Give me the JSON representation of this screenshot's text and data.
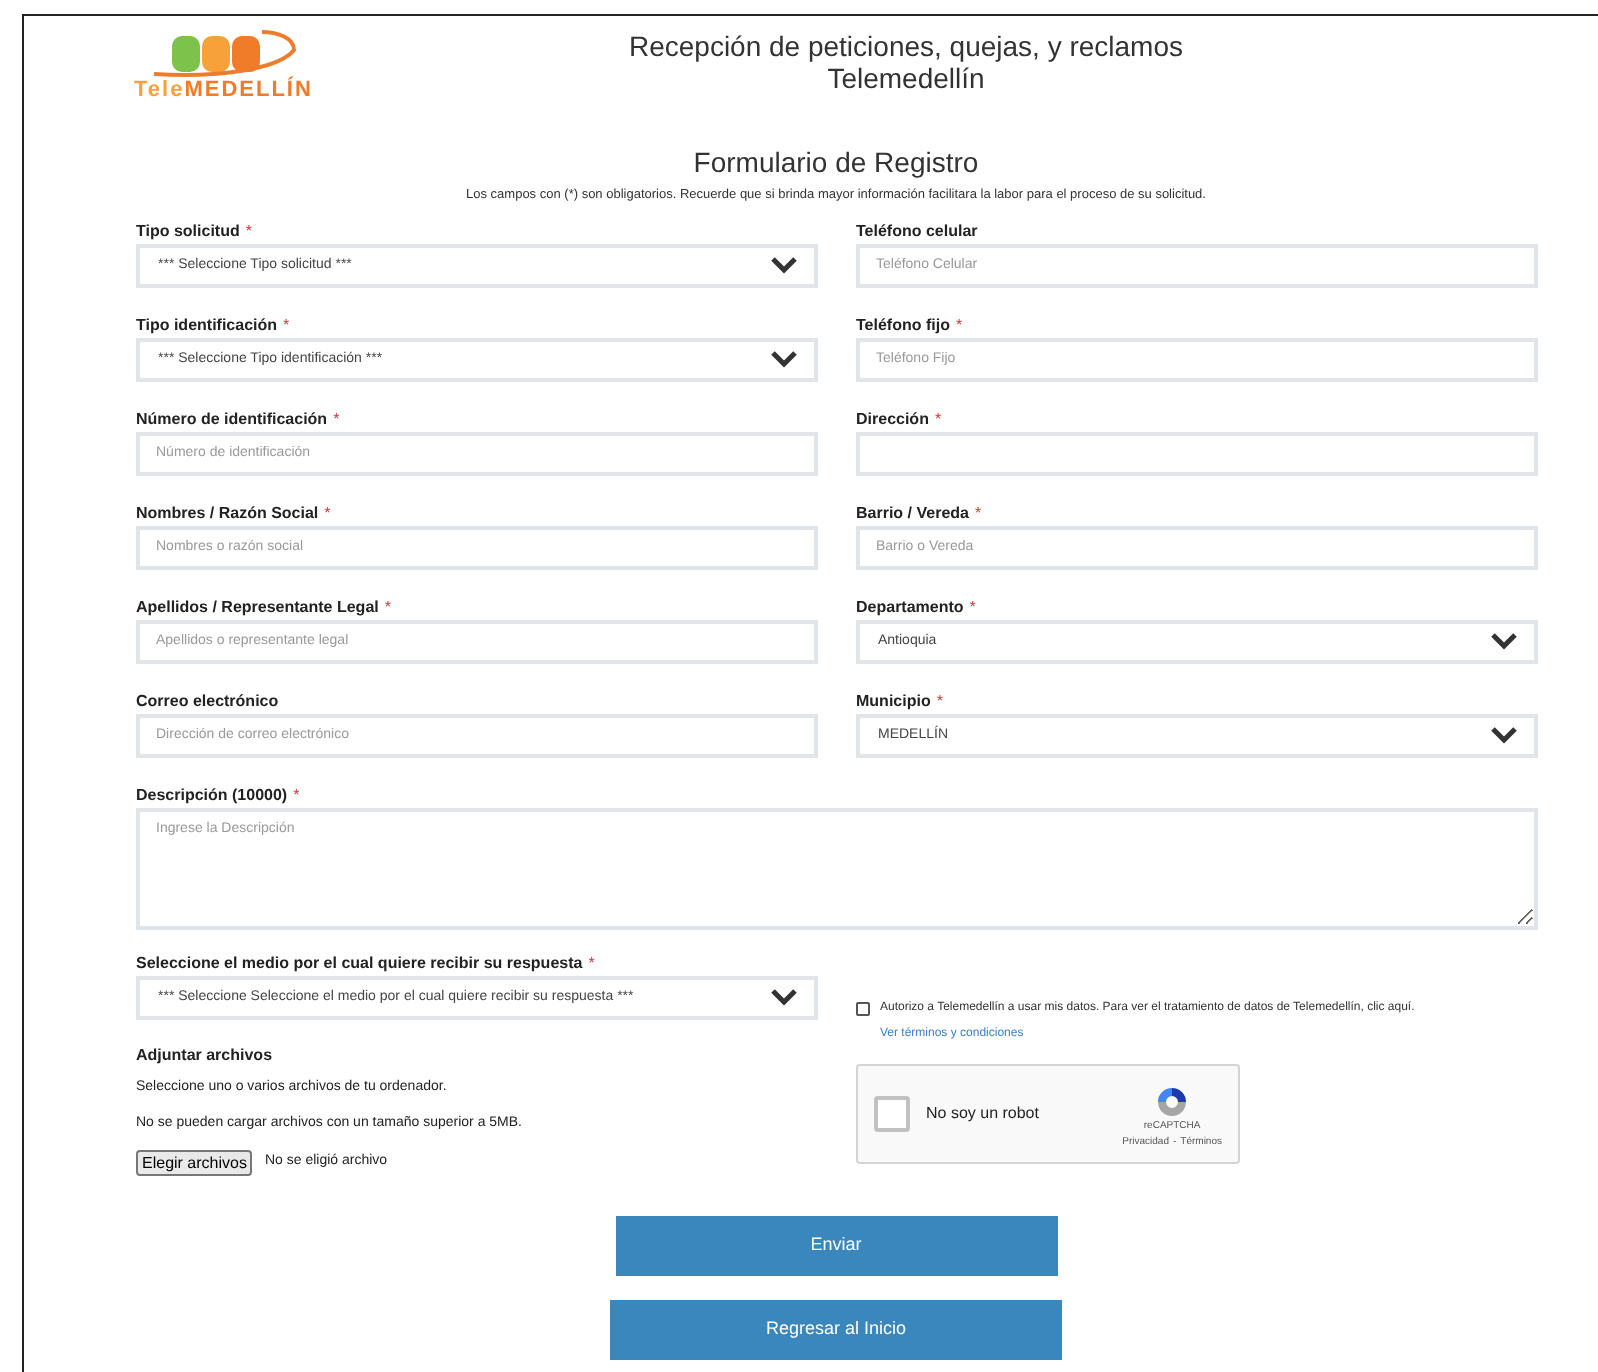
{
  "logo": {
    "part_1": "Tele",
    "part_2": "MEDELLÍN"
  },
  "header": {
    "title_line_1": "Recepción de peticiones, quejas, y reclamos",
    "title_line_2": "Telemedellín"
  },
  "form": {
    "title": "Formulario de Registro",
    "required_marker": "*",
    "note": "Los campos con (*) son obligatorios. Recuerde que si brinda mayor información facilitara la labor para el proceso de su solicitud.",
    "rows": [
      [
        {
          "kind": "select",
          "label": "Tipo solicitud",
          "required": true,
          "value": "*** Seleccione Tipo solicitud ***"
        },
        {
          "kind": "text",
          "label": "Teléfono celular",
          "required": false,
          "placeholder": "Teléfono Celular"
        }
      ],
      [
        {
          "kind": "select",
          "label": "Tipo identificación",
          "required": true,
          "value": "*** Seleccione Tipo identificación ***"
        },
        {
          "kind": "text",
          "label": "Teléfono fijo",
          "required": true,
          "placeholder": "Teléfono Fijo"
        }
      ],
      [
        {
          "kind": "text",
          "label": "Número de identificación",
          "required": true,
          "placeholder": "Número de identificación"
        },
        {
          "kind": "text",
          "label": "Dirección",
          "required": true
        }
      ],
      [
        {
          "kind": "text",
          "label": "Nombres / Razón Social",
          "required": true,
          "placeholder": "Nombres o razón social"
        },
        {
          "kind": "text",
          "label": "Barrio / Vereda",
          "required": true,
          "placeholder": "Barrio o Vereda"
        }
      ],
      [
        {
          "kind": "text",
          "label": "Apellidos / Representante Legal",
          "required": true,
          "placeholder": "Apellidos o representante legal"
        },
        {
          "kind": "select",
          "label": "Departamento",
          "required": true,
          "value": "Antioquia"
        }
      ],
      [
        {
          "kind": "text",
          "label": "Correo electrónico",
          "required": false,
          "placeholder": "Dirección de correo electrónico"
        },
        {
          "kind": "select",
          "label": "Municipio",
          "required": true,
          "value": "MEDELLÍN"
        }
      ]
    ],
    "description": {
      "label": "Descripción (10000)",
      "required": true,
      "placeholder": "Ingrese la Descripción"
    },
    "response_medium": {
      "label": "Seleccione el medio por el cual quiere recibir su respuesta",
      "required": true,
      "value": "*** Seleccione Seleccione el medio por el cual quiere recibir su respuesta ***"
    },
    "attachments": {
      "title": "Adjuntar archivos",
      "hint_1": "Seleccione uno o varios archivos de tu ordenador.",
      "hint_2": "No se pueden cargar archivos con un tamaño superior a 5MB.",
      "button": "Elegir archivos",
      "status": "No se eligió archivo"
    },
    "consent": {
      "checked": false,
      "text": "Autorizo a Telemedellín a usar mis datos. Para ver el tratamiento de datos de Telemedellín, clic aquí.",
      "link": "Ver términos y condiciones"
    },
    "captcha": {
      "checked": false,
      "label": "No soy un robot",
      "brand": "reCAPTCHA",
      "privacy": "Privacidad",
      "separator": "-",
      "terms": "Términos"
    },
    "buttons": [
      "Enviar",
      "Regresar al Inicio"
    ]
  }
}
